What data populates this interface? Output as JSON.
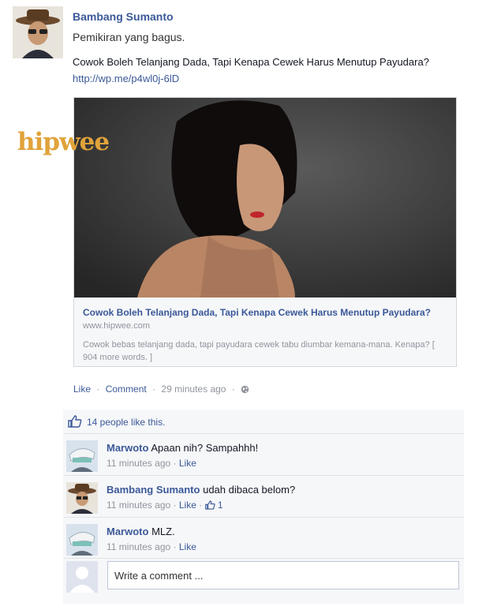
{
  "post": {
    "author": "Bambang Sumanto",
    "status": "Pemikiran yang bagus.",
    "shared_text": "Cowok Boleh Telanjang Dada, Tapi Kenapa Cewek Harus Menutup Payudara?",
    "shared_link": "http://wp.me/p4wl0j-6lD"
  },
  "watermark": "hipwee",
  "link_card": {
    "title": "Cowok Boleh Telanjang Dada, Tapi Kenapa Cewek Harus Menutup Payudara?",
    "domain": "www.hipwee.com",
    "description": "Cowok bebas telanjang dada, tapi payudara cewek tabu diumbar kemana-mana. Kenapa? [ 904 more words. ]"
  },
  "actions": {
    "like": "Like",
    "comment": "Comment",
    "time": "29 minutes ago",
    "separator": "·",
    "privacy_icon": "globe-icon"
  },
  "likes_summary": "14 people like this.",
  "comments": [
    {
      "name": "Marwoto",
      "text": "Apaan nih? Sampahhh!",
      "time": "11 minutes ago",
      "like": "Like",
      "like_count": ""
    },
    {
      "name": "Bambang Sumanto",
      "text": "udah dibaca belom?",
      "time": "11 minutes ago",
      "like": "Like",
      "like_count": "1"
    },
    {
      "name": "Marwoto",
      "text": "MLZ.",
      "time": "11 minutes ago",
      "like": "Like",
      "like_count": ""
    }
  ],
  "comment_box": {
    "placeholder": "Write a comment ..."
  },
  "colors": {
    "link": "#3b5998",
    "muted": "#90949c",
    "panel": "#f6f7f9",
    "watermark": "#e0a33a"
  }
}
